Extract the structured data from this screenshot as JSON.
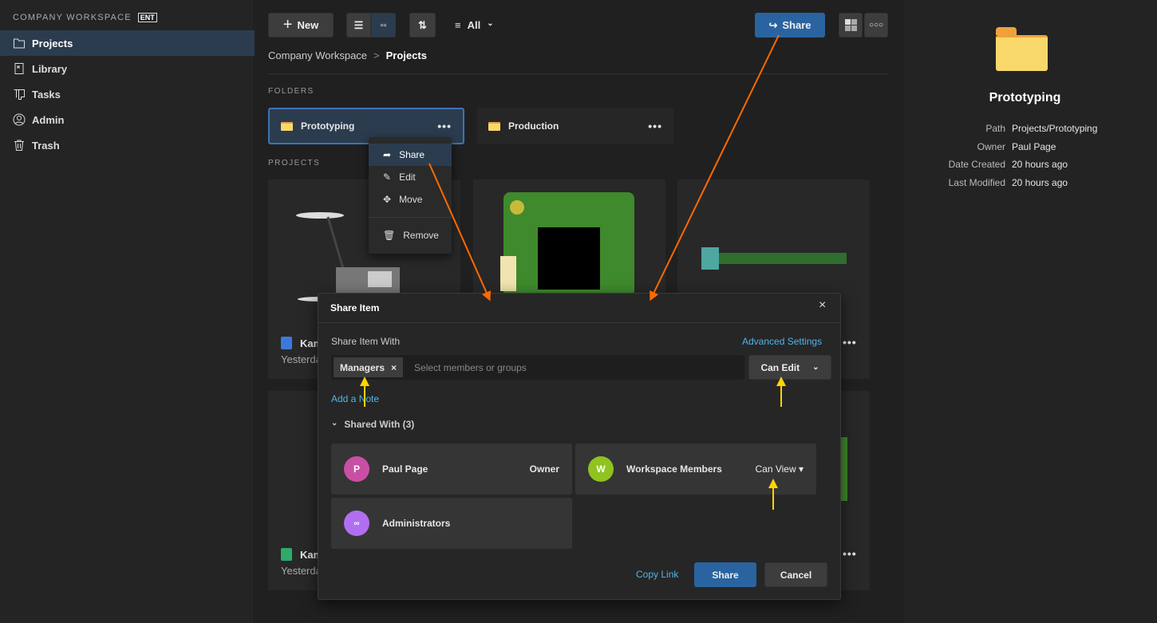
{
  "sidebar": {
    "workspace": "COMPANY WORKSPACE",
    "badge": "ENT",
    "items": [
      {
        "label": "Projects"
      },
      {
        "label": "Library"
      },
      {
        "label": "Tasks"
      },
      {
        "label": "Admin"
      },
      {
        "label": "Trash"
      }
    ]
  },
  "toolbar": {
    "new_label": "New",
    "filter_label": "All",
    "share_label": "Share"
  },
  "breadcrumb": {
    "root": "Company Workspace",
    "sep": ">",
    "current": "Projects"
  },
  "folders": {
    "heading": "FOLDERS",
    "items": [
      {
        "name": "Prototyping"
      },
      {
        "name": "Production"
      }
    ]
  },
  "projects": {
    "heading": "PROJECTS",
    "items": [
      {
        "name": "Kam",
        "date": "Yesterday"
      },
      {
        "name": "Kam",
        "date": "Yesterday"
      }
    ]
  },
  "context_menu": {
    "items": [
      {
        "label": "Share"
      },
      {
        "label": "Edit"
      },
      {
        "label": "Move"
      },
      {
        "label": "Remove"
      }
    ]
  },
  "details": {
    "title": "Prototyping",
    "rows": [
      {
        "k": "Path",
        "v": "Projects/Prototyping"
      },
      {
        "k": "Owner",
        "v": "Paul Page"
      },
      {
        "k": "Date Created",
        "v": "20 hours ago"
      },
      {
        "k": "Last Modified",
        "v": "20 hours ago"
      }
    ]
  },
  "modal": {
    "title": "Share Item",
    "close": "×",
    "share_with_label": "Share Item With",
    "advanced": "Advanced Settings",
    "chip": "Managers",
    "chip_remove": "×",
    "placeholder": "Select members or groups",
    "permission": "Can Edit",
    "add_note": "Add a Note",
    "shared_with": "Shared With (3)",
    "members": [
      {
        "initial": "P",
        "name": "Paul Page",
        "role": "Owner",
        "color": "#c94fa5"
      },
      {
        "initial": "W",
        "name": "Workspace Members",
        "role": "Can View ▾",
        "color": "#8fc320"
      },
      {
        "initial": "",
        "name": "Administrators",
        "role": "",
        "color": "#b06ff0"
      }
    ],
    "copy_link": "Copy Link",
    "share": "Share",
    "cancel": "Cancel"
  },
  "colors": {
    "accent": "#2a64a0",
    "annotation_orange": "#ff6a00",
    "annotation_yellow": "#ffd400"
  }
}
